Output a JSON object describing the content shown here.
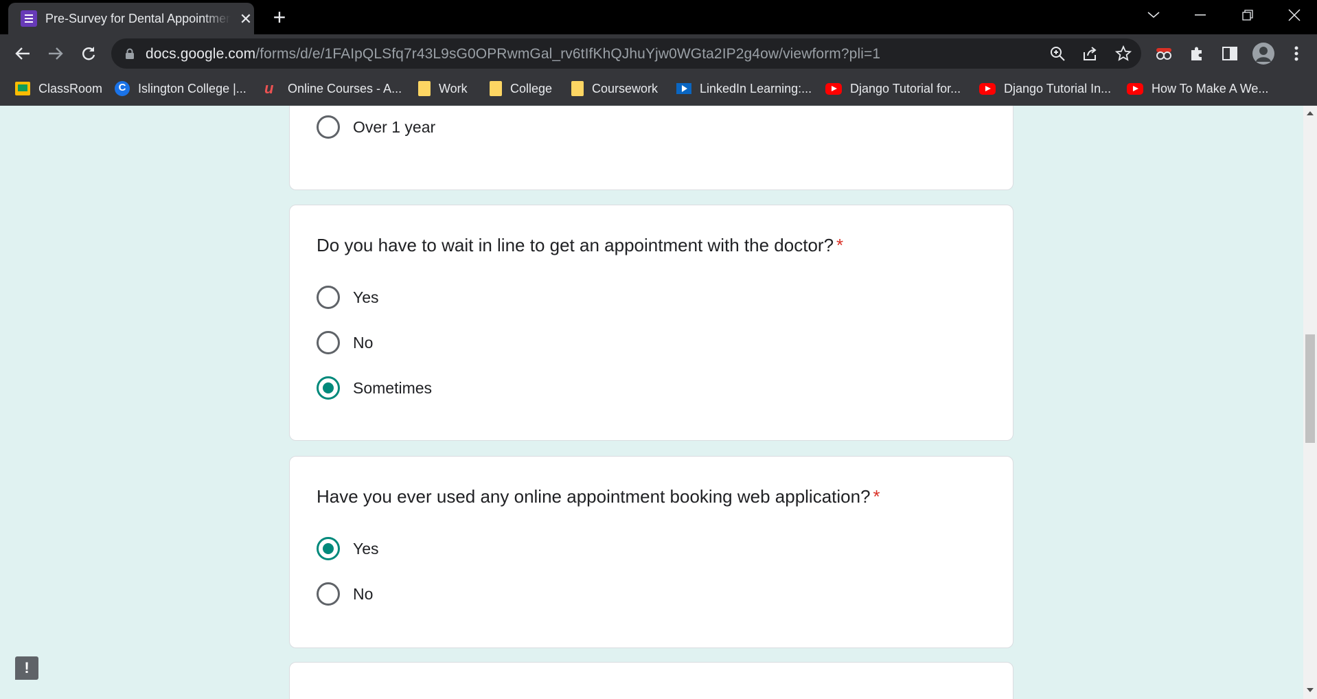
{
  "browser": {
    "tab_title": "Pre-Survey for Dental Appointment",
    "url_host": "docs.google.com",
    "url_path": "/forms/d/e/1FAIpQLSfq7r43L9sG0OPRwmGal_rv6tIfKhQJhuYjw0WGta2IP2g4ow/viewform?pli=1",
    "bookmarks": [
      {
        "label": "ClassRoom",
        "icon": "classroom-icon"
      },
      {
        "label": "Islington College |...",
        "icon": "islington-icon"
      },
      {
        "label": "Online Courses - A...",
        "icon": "udemy-icon"
      },
      {
        "label": "Work",
        "icon": "folder-icon"
      },
      {
        "label": "College",
        "icon": "folder-icon"
      },
      {
        "label": "Coursework",
        "icon": "folder-icon"
      },
      {
        "label": "LinkedIn Learning:...",
        "icon": "linkedin-learning-icon"
      },
      {
        "label": "Django Tutorial for...",
        "icon": "youtube-icon"
      },
      {
        "label": "Django Tutorial In...",
        "icon": "youtube-icon"
      },
      {
        "label": "How To Make A We...",
        "icon": "youtube-icon"
      }
    ]
  },
  "form": {
    "accent_color": "#00897b",
    "background_color": "#e0f2f1",
    "partial_card": {
      "options": [
        {
          "label": "Over 1 year",
          "checked": false
        }
      ]
    },
    "questions": [
      {
        "text": "Do you have to wait in line to get an appointment with the doctor?",
        "required_mark": "*",
        "options": [
          {
            "label": "Yes",
            "checked": false
          },
          {
            "label": "No",
            "checked": false
          },
          {
            "label": "Sometimes",
            "checked": true
          }
        ]
      },
      {
        "text": "Have you ever used any online appointment booking web application?",
        "required_mark": "*",
        "options": [
          {
            "label": "Yes",
            "checked": true
          },
          {
            "label": "No",
            "checked": false
          }
        ]
      }
    ]
  }
}
